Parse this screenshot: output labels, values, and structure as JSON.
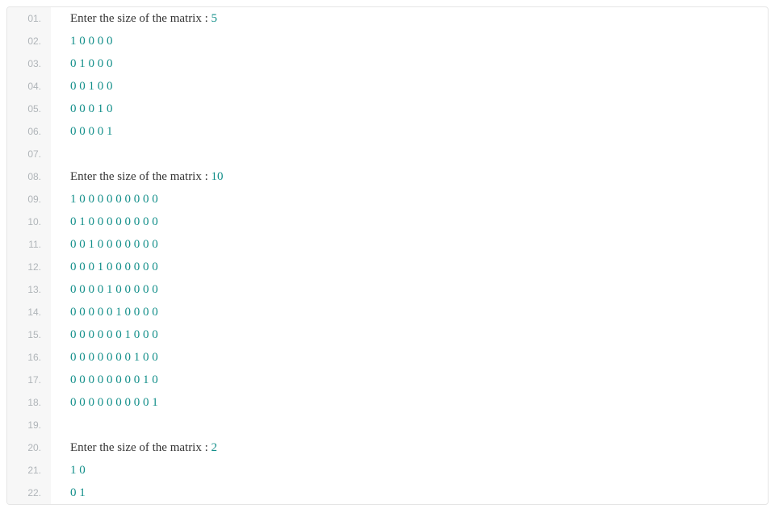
{
  "prompt_text": "Enter the size of the matrix : ",
  "lines": [
    {
      "num": "01.",
      "type": "prompt",
      "value": "5"
    },
    {
      "num": "02.",
      "type": "numbers",
      "values": [
        "1",
        "0",
        "0",
        "0",
        "0"
      ]
    },
    {
      "num": "03.",
      "type": "numbers",
      "values": [
        "0",
        "1",
        "0",
        "0",
        "0"
      ]
    },
    {
      "num": "04.",
      "type": "numbers",
      "values": [
        "0",
        "0",
        "1",
        "0",
        "0"
      ]
    },
    {
      "num": "05.",
      "type": "numbers",
      "values": [
        "0",
        "0",
        "0",
        "1",
        "0"
      ]
    },
    {
      "num": "06.",
      "type": "numbers",
      "values": [
        "0",
        "0",
        "0",
        "0",
        "1"
      ]
    },
    {
      "num": "07.",
      "type": "blank"
    },
    {
      "num": "08.",
      "type": "prompt",
      "value": "10"
    },
    {
      "num": "09.",
      "type": "numbers",
      "values": [
        "1",
        "0",
        "0",
        "0",
        "0",
        "0",
        "0",
        "0",
        "0",
        "0"
      ]
    },
    {
      "num": "10.",
      "type": "numbers",
      "values": [
        "0",
        "1",
        "0",
        "0",
        "0",
        "0",
        "0",
        "0",
        "0",
        "0"
      ]
    },
    {
      "num": "11.",
      "type": "numbers",
      "values": [
        "0",
        "0",
        "1",
        "0",
        "0",
        "0",
        "0",
        "0",
        "0",
        "0"
      ]
    },
    {
      "num": "12.",
      "type": "numbers",
      "values": [
        "0",
        "0",
        "0",
        "1",
        "0",
        "0",
        "0",
        "0",
        "0",
        "0"
      ]
    },
    {
      "num": "13.",
      "type": "numbers",
      "values": [
        "0",
        "0",
        "0",
        "0",
        "1",
        "0",
        "0",
        "0",
        "0",
        "0"
      ]
    },
    {
      "num": "14.",
      "type": "numbers",
      "values": [
        "0",
        "0",
        "0",
        "0",
        "0",
        "1",
        "0",
        "0",
        "0",
        "0"
      ]
    },
    {
      "num": "15.",
      "type": "numbers",
      "values": [
        "0",
        "0",
        "0",
        "0",
        "0",
        "0",
        "1",
        "0",
        "0",
        "0"
      ]
    },
    {
      "num": "16.",
      "type": "numbers",
      "values": [
        "0",
        "0",
        "0",
        "0",
        "0",
        "0",
        "0",
        "1",
        "0",
        "0"
      ]
    },
    {
      "num": "17.",
      "type": "numbers",
      "values": [
        "0",
        "0",
        "0",
        "0",
        "0",
        "0",
        "0",
        "0",
        "1",
        "0"
      ]
    },
    {
      "num": "18.",
      "type": "numbers",
      "values": [
        "0",
        "0",
        "0",
        "0",
        "0",
        "0",
        "0",
        "0",
        "0",
        "1"
      ]
    },
    {
      "num": "19.",
      "type": "blank"
    },
    {
      "num": "20.",
      "type": "prompt",
      "value": "2"
    },
    {
      "num": "21.",
      "type": "numbers",
      "values": [
        "1",
        "0"
      ]
    },
    {
      "num": "22.",
      "type": "numbers",
      "values": [
        "0",
        "1"
      ]
    }
  ]
}
